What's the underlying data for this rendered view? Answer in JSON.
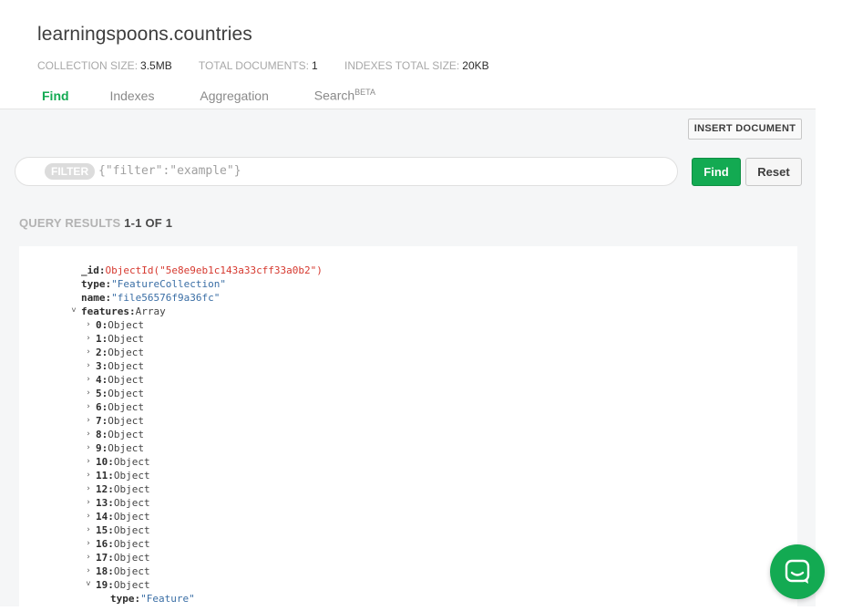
{
  "collection": {
    "title": "learningspoons.countries",
    "stats": [
      {
        "label": "COLLECTION SIZE:",
        "value": "3.5MB"
      },
      {
        "label": "TOTAL DOCUMENTS:",
        "value": "1"
      },
      {
        "label": "INDEXES TOTAL SIZE:",
        "value": "20KB"
      }
    ]
  },
  "tabs": [
    {
      "label": "Find",
      "active": true
    },
    {
      "label": "Indexes",
      "active": false
    },
    {
      "label": "Aggregation",
      "active": false
    },
    {
      "label": "Search",
      "sup": "BETA",
      "active": false
    }
  ],
  "toolbar": {
    "insert_label": "INSERT DOCUMENT",
    "filter_pill": "FILTER",
    "filter_placeholder": "{\"filter\":\"example\"}",
    "find_label": "Find",
    "reset_label": "Reset"
  },
  "results": {
    "label": "QUERY RESULTS",
    "range": "1-1 OF 1"
  },
  "document": {
    "fields": [
      {
        "key": "_id",
        "value": "ObjectId(\"5e8e9eb1c143a33cff33a0b2\")",
        "kind": "oid"
      },
      {
        "key": "type",
        "value": "\"FeatureCollection\"",
        "kind": "str"
      },
      {
        "key": "name",
        "value": "\"file56576f9a36fc\"",
        "kind": "str"
      }
    ],
    "features": {
      "key": "features",
      "value": "Array",
      "items": [
        {
          "key": "0",
          "value": "Object"
        },
        {
          "key": "1",
          "value": "Object"
        },
        {
          "key": "2",
          "value": "Object"
        },
        {
          "key": "3",
          "value": "Object"
        },
        {
          "key": "4",
          "value": "Object"
        },
        {
          "key": "5",
          "value": "Object"
        },
        {
          "key": "6",
          "value": "Object"
        },
        {
          "key": "7",
          "value": "Object"
        },
        {
          "key": "8",
          "value": "Object"
        },
        {
          "key": "9",
          "value": "Object"
        },
        {
          "key": "10",
          "value": "Object"
        },
        {
          "key": "11",
          "value": "Object"
        },
        {
          "key": "12",
          "value": "Object"
        },
        {
          "key": "13",
          "value": "Object"
        },
        {
          "key": "14",
          "value": "Object"
        },
        {
          "key": "15",
          "value": "Object"
        },
        {
          "key": "16",
          "value": "Object"
        },
        {
          "key": "17",
          "value": "Object"
        },
        {
          "key": "18",
          "value": "Object"
        },
        {
          "key": "19",
          "value": "Object",
          "expanded": true
        }
      ],
      "expanded_child": {
        "key": "type",
        "value": "\"Feature\""
      }
    }
  },
  "colors": {
    "accent": "#13aa52",
    "oid": "#d6392f",
    "string": "#3a6ea5"
  },
  "icons": {
    "expand": "chevron-right-icon",
    "collapse": "chevron-down-icon",
    "chat": "chat-bubble-icon"
  }
}
